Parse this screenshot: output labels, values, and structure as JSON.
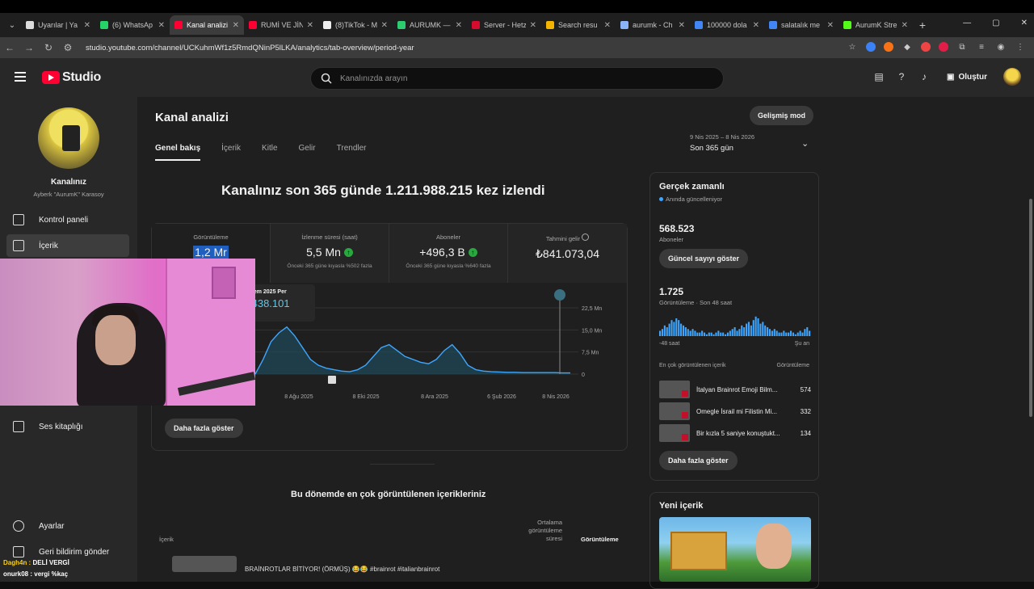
{
  "browser": {
    "tabs": [
      {
        "title": "Uyarılar | Ya",
        "color": "#dddddd"
      },
      {
        "title": "(6) WhatsAp",
        "color": "#25d366"
      },
      {
        "title": "Kanal analizi",
        "color": "#ff0033",
        "active": true
      },
      {
        "title": "RUMİ VE JİN",
        "color": "#ff0033"
      },
      {
        "title": "(8)TikTok - M",
        "color": "#eeeeee"
      },
      {
        "title": "AURUMK —",
        "color": "#2ecc71"
      },
      {
        "title": "Server - Hetz",
        "color": "#d50c2d"
      },
      {
        "title": "Search resu",
        "color": "#f4b400"
      },
      {
        "title": "aurumk - Ch",
        "color": "#8ab4f8"
      },
      {
        "title": "100000 dola",
        "color": "#4285f4"
      },
      {
        "title": "salatalık me",
        "color": "#4285f4"
      },
      {
        "title": "AurumK Stre",
        "color": "#53fc18"
      }
    ],
    "url": "studio.youtube.com/channel/UCKuhmWf1z5RmdQNinP5lLKA/analytics/tab-overview/period-year"
  },
  "header": {
    "logo_text": "Studio",
    "search_placeholder": "Kanalınızda arayın",
    "create_label": "Oluştur"
  },
  "sidebar": {
    "channel_title": "Kanalınız",
    "channel_sub": "Ayberk \"AurumK\" Karasoy",
    "items": [
      {
        "label": "Kontrol paneli"
      },
      {
        "label": "İçerik"
      },
      {
        "label": "Ses kitaplığı"
      },
      {
        "label": "Ayarlar"
      },
      {
        "label": "Geri bildirim gönder"
      }
    ]
  },
  "page": {
    "title": "Kanal analizi",
    "advanced_mode": "Gelişmiş mod",
    "tabs": [
      "Genel bakış",
      "İçerik",
      "Kitle",
      "Gelir",
      "Trendler"
    ],
    "date_range": "9 Nis 2025 – 8 Nis 2026",
    "period": "Son 365 gün",
    "headline": "Kanalınız son 365 günde 1.211.988.215 kez izlendi"
  },
  "metrics": [
    {
      "label": "Görüntüleme",
      "value": "1,2 Mr",
      "compare": ""
    },
    {
      "label": "İzlenme süresi (saat)",
      "value": "5,5 Mn",
      "compare": "Önceki 365 güne kıyasla %502 fazla"
    },
    {
      "label": "Aboneler",
      "value": "+496,3 B",
      "compare": "Önceki 365 güne kıyasla %640 fazla"
    },
    {
      "label": "Tahmini gelir",
      "value": "₺841.073,04",
      "compare": ""
    }
  ],
  "tooltip": {
    "date": "...em 2025 Per",
    "value": ".438.101"
  },
  "chart_data": {
    "type": "area",
    "x_tick_labels": [
      "8 Ağu 2025",
      "8 Eki 2025",
      "8 Ara 2025",
      "6 Şub 2026",
      "8 Nis 2026"
    ],
    "y_tick_labels": [
      "22,5 Mn",
      "15,0 Mn",
      "7,5 Mn",
      "0"
    ],
    "ylim": [
      0,
      22500000
    ],
    "series": [
      {
        "values": [
          0,
          5,
          11,
          14,
          16,
          13,
          9,
          5,
          3,
          2,
          1.5,
          1,
          0.8,
          1.5,
          3,
          6,
          9,
          10,
          8,
          6,
          5,
          4,
          3.5,
          5,
          8,
          10,
          7,
          3,
          1.5,
          1,
          0.8,
          0.7,
          0.6,
          0.6,
          0.5,
          0.5,
          0.5,
          0.5,
          0.5,
          0.4,
          0.4
        ]
      }
    ],
    "color": "#3ea6ff"
  },
  "more_label": "Daha fazla göster",
  "top_content": {
    "title": "Bu dönemde en çok görüntülenen içerikleriniz",
    "col_content": "İçerik",
    "col_avg": "Ortalama görüntüleme süresi",
    "col_views": "Görüntüleme",
    "first_row": "BRAİNROTLAR BİTİYOR! (ÖRMÜŞ) 😂😂 #brainrot #italianbrainrot"
  },
  "realtime": {
    "title": "Gerçek zamanlı",
    "live": "Anında güncelleniyor",
    "subs": "568.523",
    "subs_label": "Aboneler",
    "show_current": "Güncel sayıyı göster",
    "views": "1.725",
    "views_label": "Görüntüleme · Son 48 saat",
    "axis_left": "-48 saat",
    "axis_right": "Şu an",
    "top_label": "En çok görüntülenen içerik",
    "top_col": "Görüntüleme",
    "rows": [
      {
        "name": "İtalyan Brainrot Emoji Bilm...",
        "count": "574"
      },
      {
        "name": "Omegle İsrail mi Filistin Mi...",
        "count": "332"
      },
      {
        "name": "Bir kızla 5 saniye konuştukt...",
        "count": "134"
      }
    ],
    "bars": [
      3,
      4,
      6,
      5,
      7,
      9,
      8,
      10,
      9,
      7,
      6,
      5,
      4,
      3,
      4,
      3,
      2,
      2,
      3,
      2,
      1,
      2,
      2,
      1,
      2,
      3,
      2,
      2,
      1,
      2,
      3,
      4,
      5,
      3,
      4,
      6,
      5,
      7,
      8,
      6,
      9,
      11,
      10,
      7,
      8,
      6,
      5,
      4,
      3,
      4,
      3,
      2,
      2,
      3,
      2,
      2,
      3,
      2,
      1,
      2,
      3,
      2,
      4,
      5,
      3
    ]
  },
  "new_content": {
    "title": "Yeni içerik"
  },
  "chat": [
    {
      "name": "Dagh4n :",
      "msg": "DELİ VERGİ"
    },
    {
      "name": "onurk08 :",
      "msg": "vergi %kaç"
    }
  ]
}
